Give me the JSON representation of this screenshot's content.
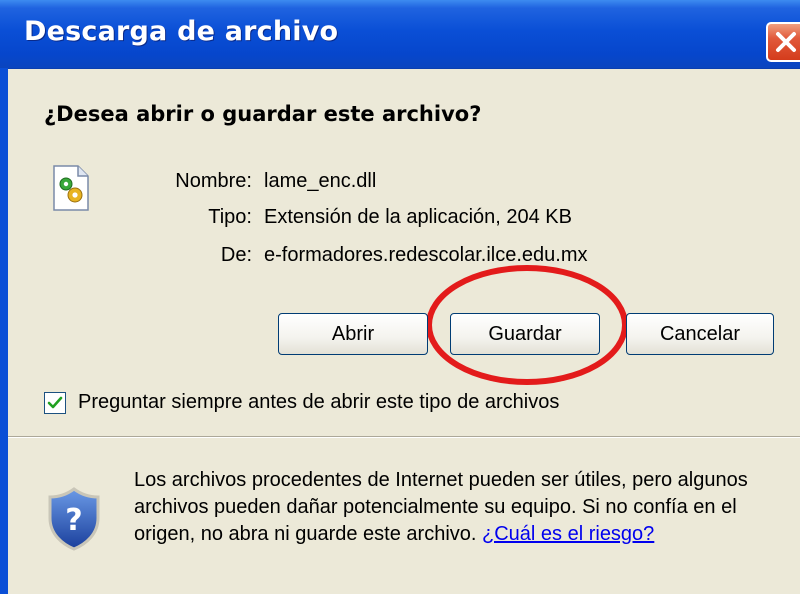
{
  "window": {
    "title": "Descarga de archivo"
  },
  "dialog": {
    "question": "¿Desea abrir o guardar este archivo?",
    "file": {
      "name_label": "Nombre:",
      "name_value": "lame_enc.dll",
      "type_label": "Tipo:",
      "type_value": "Extensión de la aplicación, 204 KB",
      "from_label": "De:",
      "from_value": "e-formadores.redescolar.ilce.edu.mx"
    },
    "buttons": {
      "open": "Abrir",
      "save": "Guardar",
      "cancel": "Cancelar"
    },
    "always_ask": {
      "checked": true,
      "label": "Preguntar siempre antes de abrir este tipo de archivos"
    },
    "warning": {
      "text": "Los archivos procedentes de Internet pueden ser útiles, pero algunos archivos pueden dañar potencialmente su equipo. Si no confía en el origen, no abra ni guarde este archivo. ",
      "link": "¿Cuál es el riesgo?"
    }
  },
  "colors": {
    "titlebar": "#0a4fd6",
    "dialog_bg": "#ece9d8",
    "highlight_ellipse": "#e31b1b",
    "link": "#0000ee"
  },
  "icons": {
    "close": "close-icon",
    "file": "dll-file-icon",
    "checkbox": "checkmark-icon",
    "security": "security-shield-question-icon"
  }
}
